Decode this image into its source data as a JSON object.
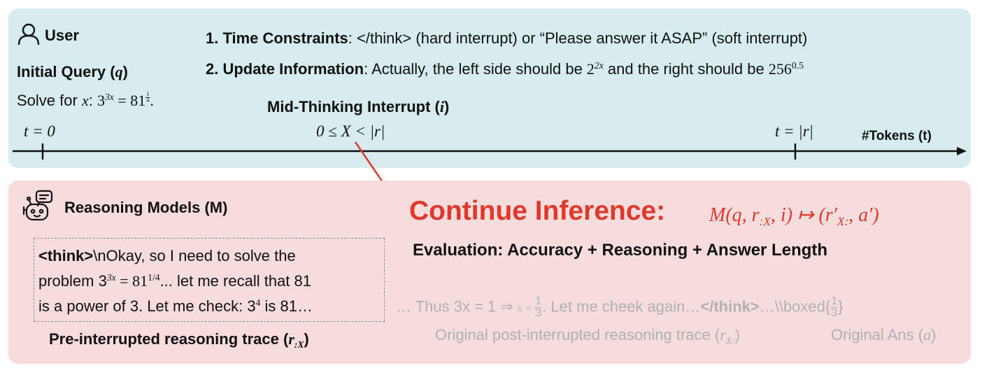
{
  "user": {
    "label": "User",
    "initial_query_label": "Initial Query (",
    "initial_query_var": "q",
    "initial_query_close": ")",
    "solve_prefix": "Solve for ",
    "solve_var": "x",
    "solve_colon": ":",
    "equation_lhs": "3",
    "equation_lhs_exp": "3x",
    "equation_eq": " = 81",
    "equation_frac_num": "1",
    "equation_frac_den": "4",
    "equation_end": "."
  },
  "constraints": {
    "time_label": "1. Time Constraints",
    "time_text": ": </think> (hard interrupt) or “Please answer it ASAP” (soft interrupt)",
    "update_label": "2. Update Information",
    "update_text": ": Actually, the left side should be ",
    "update_left_base": "2",
    "update_left_exp": "2x",
    "update_mid": " and the right should be ",
    "update_right_base": "256",
    "update_right_exp": "0.5"
  },
  "timeline": {
    "interrupt_label": "Mid-Thinking Interrupt (",
    "interrupt_var": "i",
    "interrupt_close": ")",
    "t_start": "t = 0",
    "t_mid": "0 ≤ X < |r|",
    "t_end": "t = |r|",
    "axis_label": "#Tokens (t)"
  },
  "model": {
    "label": "Reasoning Models (M)",
    "continue_label": "Continue Inference:",
    "formula_prefix": "M(q, r",
    "formula_sub1": ":X",
    "formula_mid": ", i) ↦ (r′",
    "formula_sub2": "X:",
    "formula_end": ", a′)",
    "evaluation": "Evaluation: Accuracy + Reasoning + Answer Length"
  },
  "trace": {
    "think_tag": "<think>",
    "line1_rest": "\\nOkay, so I need to solve the",
    "line2_pre": "problem 3",
    "line2_exp": "3x",
    "line2_mid": " = 81",
    "line2_exp2": "1/4",
    "line2_post": "... let me recall that 81",
    "line3_pre": "is a power of 3. Let me check: 3",
    "line3_exp": "4",
    "line3_post": " is 81…",
    "caption": "Pre-interrupted reasoning trace (",
    "caption_var": "r",
    "caption_sub": ":X",
    "caption_close": ")"
  },
  "original": {
    "ellipsis": "… Thus 3x = 1 ⇒ ",
    "x_eq": "x = ",
    "frac_num": "1",
    "frac_den": "3",
    "mid": ". Let me cheek again…",
    "think_close": "</think>",
    "boxed": "…\\\\boxed{",
    "boxed_num": "1",
    "boxed_den": "3",
    "boxed_close": "}",
    "post_trace_label": "Original post-interrupted reasoning trace (",
    "post_trace_var": "r",
    "post_trace_sub": "X:",
    "post_trace_close": ")",
    "ans_label": "Original Ans (",
    "ans_var": "a",
    "ans_close": ")"
  },
  "colors": {
    "top_panel": "#d6ecee",
    "bottom_panel": "#f6dcdc",
    "accent_red": "#e0392b",
    "muted_gray": "#b1b1b1"
  },
  "icons": [
    "user-icon",
    "robot-icon"
  ]
}
